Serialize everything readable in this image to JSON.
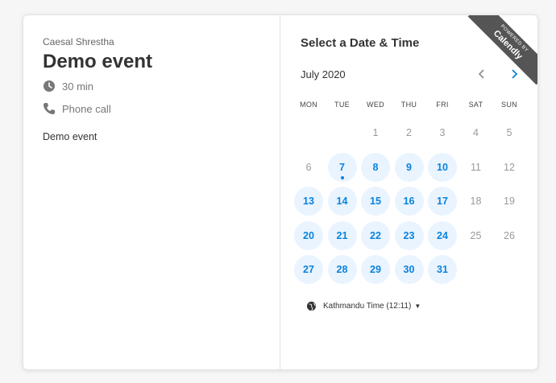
{
  "event": {
    "host": "Caesal Shrestha",
    "title": "Demo event",
    "duration": "30 min",
    "location": "Phone call",
    "description": "Demo event"
  },
  "picker": {
    "title": "Select a Date & Time",
    "month_label": "July 2020",
    "weekdays": [
      "MON",
      "TUE",
      "WED",
      "THU",
      "FRI",
      "SAT",
      "SUN"
    ],
    "days": [
      {
        "label": "1",
        "available": false
      },
      {
        "label": "2",
        "available": false
      },
      {
        "label": "3",
        "available": false
      },
      {
        "label": "4",
        "available": false
      },
      {
        "label": "5",
        "available": false
      },
      {
        "label": "6",
        "available": false
      },
      {
        "label": "7",
        "available": true,
        "today": true
      },
      {
        "label": "8",
        "available": true
      },
      {
        "label": "9",
        "available": true
      },
      {
        "label": "10",
        "available": true
      },
      {
        "label": "11",
        "available": false
      },
      {
        "label": "12",
        "available": false
      },
      {
        "label": "13",
        "available": true
      },
      {
        "label": "14",
        "available": true
      },
      {
        "label": "15",
        "available": true
      },
      {
        "label": "16",
        "available": true
      },
      {
        "label": "17",
        "available": true
      },
      {
        "label": "18",
        "available": false
      },
      {
        "label": "19",
        "available": false
      },
      {
        "label": "20",
        "available": true
      },
      {
        "label": "21",
        "available": true
      },
      {
        "label": "22",
        "available": true
      },
      {
        "label": "23",
        "available": true
      },
      {
        "label": "24",
        "available": true
      },
      {
        "label": "25",
        "available": false
      },
      {
        "label": "26",
        "available": false
      },
      {
        "label": "27",
        "available": true
      },
      {
        "label": "28",
        "available": true
      },
      {
        "label": "29",
        "available": true
      },
      {
        "label": "30",
        "available": true
      },
      {
        "label": "31",
        "available": true
      }
    ],
    "timezone": "Kathmandu Time (12:11)"
  },
  "branding": {
    "line1": "POWERED BY",
    "line2": "Calendly"
  },
  "colors": {
    "accent": "#0a82dc",
    "available_bg": "#e9f4ff"
  },
  "icons": {
    "duration": "clock-icon",
    "location": "phone-icon",
    "prev": "chevron-left-icon",
    "next": "chevron-right-icon",
    "timezone": "globe-icon",
    "tz_caret": "caret-down-icon"
  }
}
